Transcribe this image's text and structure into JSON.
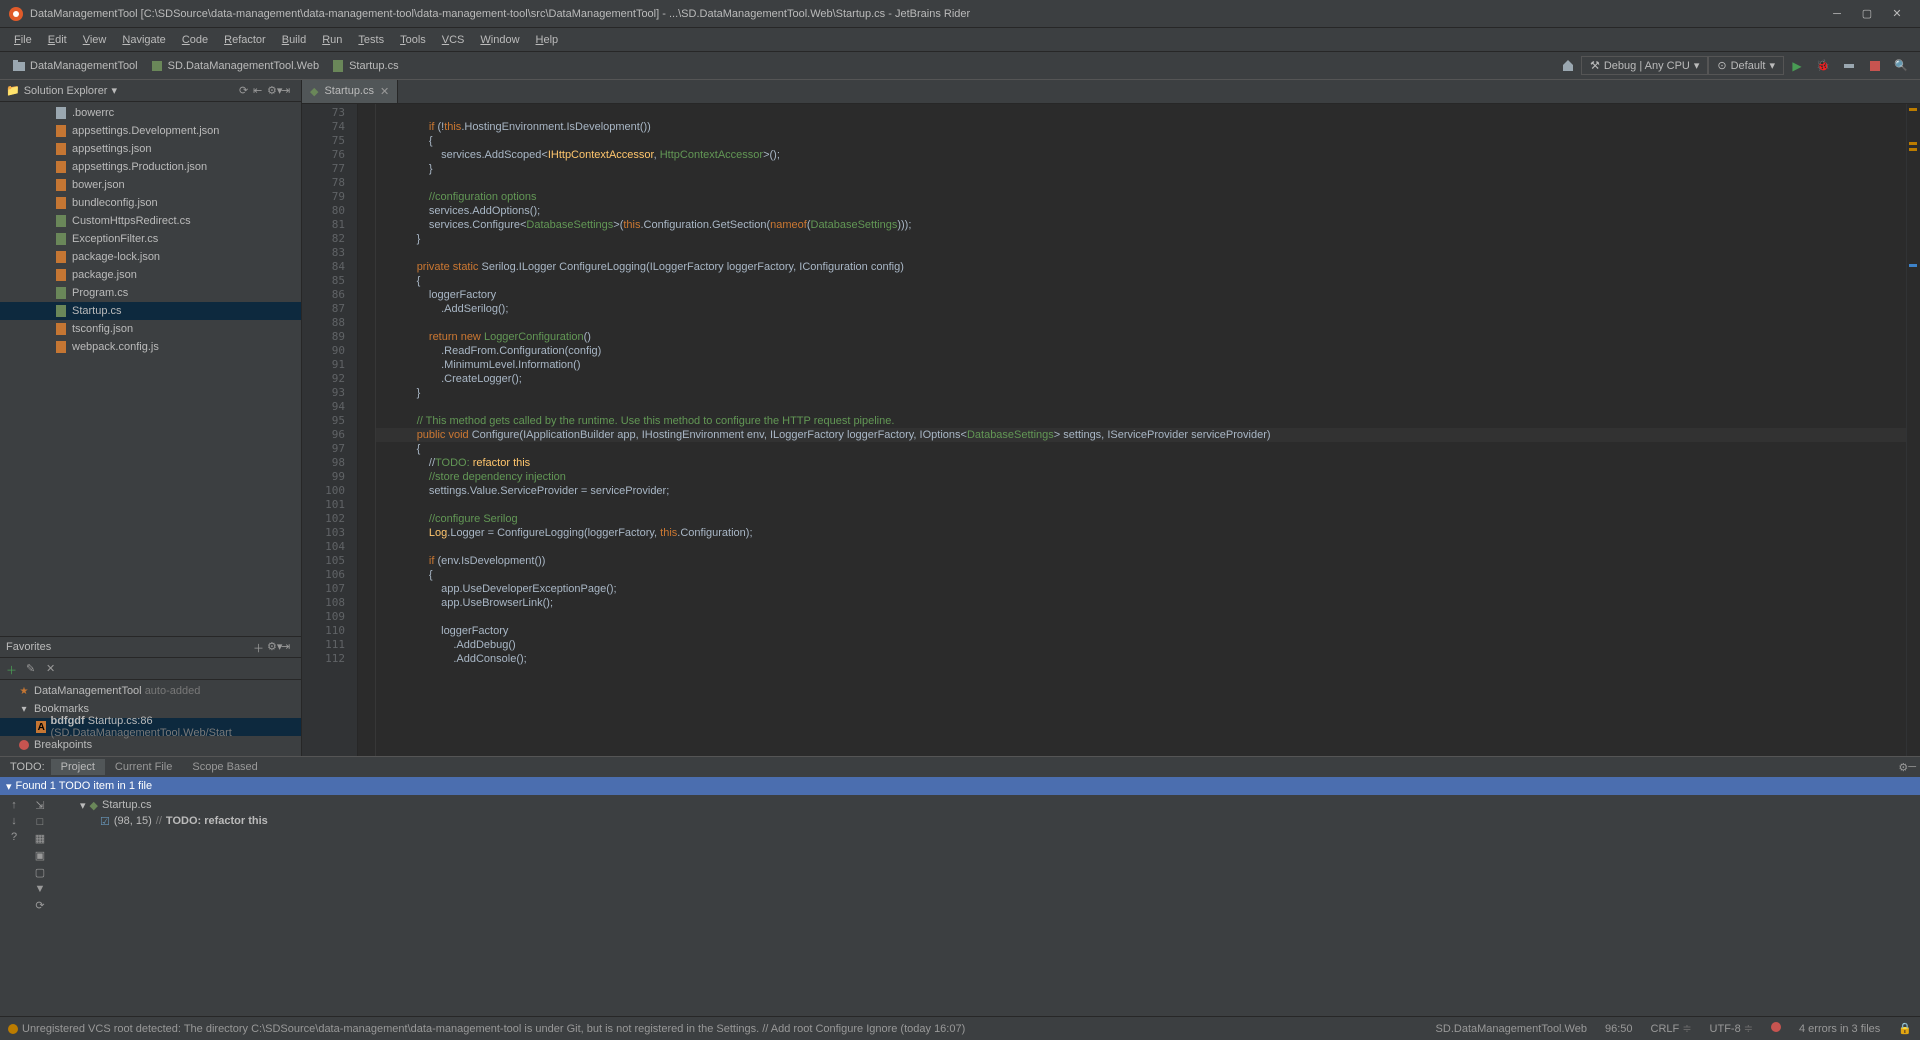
{
  "title": "DataManagementTool [C:\\SDSource\\data-management\\data-management-tool\\data-management-tool\\src\\DataManagementTool] - ...\\SD.DataManagementTool.Web\\Startup.cs - JetBrains Rider",
  "menus": [
    "File",
    "Edit",
    "View",
    "Navigate",
    "Code",
    "Refactor",
    "Build",
    "Run",
    "Tests",
    "Tools",
    "VCS",
    "Window",
    "Help"
  ],
  "crumbs": [
    "DataManagementTool",
    "SD.DataManagementTool.Web",
    "Startup.cs"
  ],
  "run_cfg": "Debug | Any CPU",
  "run_target": "Default",
  "solution_title": "Solution Explorer",
  "tree_items": [
    {
      "name": ".bowerrc",
      "t": "file"
    },
    {
      "name": "appsettings.Development.json",
      "t": "json"
    },
    {
      "name": "appsettings.json",
      "t": "json"
    },
    {
      "name": "appsettings.Production.json",
      "t": "json"
    },
    {
      "name": "bower.json",
      "t": "json"
    },
    {
      "name": "bundleconfig.json",
      "t": "json"
    },
    {
      "name": "CustomHttpsRedirect.cs",
      "t": "cs"
    },
    {
      "name": "ExceptionFilter.cs",
      "t": "cs"
    },
    {
      "name": "package-lock.json",
      "t": "json"
    },
    {
      "name": "package.json",
      "t": "json"
    },
    {
      "name": "Program.cs",
      "t": "cs"
    },
    {
      "name": "Startup.cs",
      "t": "cs",
      "sel": true
    },
    {
      "name": "tsconfig.json",
      "t": "json"
    },
    {
      "name": "webpack.config.js",
      "t": "js"
    }
  ],
  "fav_title": "Favorites",
  "fav_items": [
    {
      "txt": "DataManagementTool",
      "suffix": "auto-added",
      "star": true
    },
    {
      "txt": "Bookmarks",
      "exp": true
    },
    {
      "txt": "bdfgdf Startup.cs:86 (SD.DataManagementTool.Web/Start",
      "sel": true,
      "bm": true
    },
    {
      "txt": "Breakpoints",
      "bp": true
    }
  ],
  "tab_name": "Startup.cs",
  "first_line": 73,
  "code_lines": [
    {
      "n": 73,
      "txt": ""
    },
    {
      "n": 74,
      "txt": "                if (!this.HostingEnvironment.IsDevelopment())",
      "tokens": [
        [
          "                ",
          ""
        ],
        [
          "if",
          "kw"
        ],
        [
          " (!",
          ""
        ],
        [
          "this",
          "kw"
        ],
        [
          ".HostingEnvironment.IsDevelopment())",
          ""
        ]
      ]
    },
    {
      "n": 75,
      "txt": "                {"
    },
    {
      "n": 76,
      "txt": "                    services.AddScoped<IHttpContextAccessor, HttpContextAccessor>();",
      "tokens": [
        [
          "                    services.AddScoped<",
          ""
        ],
        [
          "IHttpContextAccessor",
          "cls"
        ],
        [
          ", ",
          ""
        ],
        [
          "HttpContextAccessor",
          "cmt-grn"
        ],
        [
          ">();",
          ""
        ]
      ]
    },
    {
      "n": 77,
      "txt": "                }"
    },
    {
      "n": 78,
      "txt": ""
    },
    {
      "n": 79,
      "txt": "                //configuration options",
      "tokens": [
        [
          "                ",
          ""
        ],
        [
          "//configuration options",
          "cmt-grn"
        ]
      ]
    },
    {
      "n": 80,
      "txt": "                services.AddOptions();"
    },
    {
      "n": 81,
      "txt": "                services.Configure<DatabaseSettings>(this.Configuration.GetSection(nameof(DatabaseSettings)));",
      "tokens": [
        [
          "                services.Configure<",
          ""
        ],
        [
          "DatabaseSettings",
          "cmt-grn"
        ],
        [
          ">(",
          ""
        ],
        [
          "this",
          "kw"
        ],
        [
          ".Configuration.GetSection(",
          ""
        ],
        [
          "nameof",
          "kw"
        ],
        [
          "(",
          ""
        ],
        [
          "DatabaseSettings",
          "cmt-grn"
        ],
        [
          ")));",
          ""
        ]
      ]
    },
    {
      "n": 82,
      "txt": "            }"
    },
    {
      "n": 83,
      "txt": ""
    },
    {
      "n": 84,
      "txt": "            private static Serilog.ILogger ConfigureLogging(ILoggerFactory loggerFactory, IConfiguration config)",
      "tokens": [
        [
          "            ",
          ""
        ],
        [
          "private static",
          "kw"
        ],
        [
          " Serilog.",
          ""
        ],
        [
          "ILogger",
          "type"
        ],
        [
          " ConfigureLogging(",
          ""
        ],
        [
          "ILoggerFactory",
          "type"
        ],
        [
          " loggerFactory, ",
          ""
        ],
        [
          "IConfiguration",
          "type"
        ],
        [
          " config)",
          ""
        ]
      ]
    },
    {
      "n": 85,
      "txt": "            {"
    },
    {
      "n": 86,
      "txt": "                loggerFactory",
      "gutter_mark": "A"
    },
    {
      "n": 87,
      "txt": "                    .AddSerilog();"
    },
    {
      "n": 88,
      "txt": ""
    },
    {
      "n": 89,
      "txt": "                return new LoggerConfiguration()",
      "tokens": [
        [
          "                ",
          ""
        ],
        [
          "return new",
          "kw"
        ],
        [
          " ",
          ""
        ],
        [
          "LoggerConfiguration",
          "cmt-grn"
        ],
        [
          "()",
          ""
        ]
      ]
    },
    {
      "n": 90,
      "txt": "                    .ReadFrom.Configuration(config)"
    },
    {
      "n": 91,
      "txt": "                    .MinimumLevel.Information()"
    },
    {
      "n": 92,
      "txt": "                    .CreateLogger();"
    },
    {
      "n": 93,
      "txt": "            }"
    },
    {
      "n": 94,
      "txt": ""
    },
    {
      "n": 95,
      "txt": "            // This method gets called by the runtime. Use this method to configure the HTTP request pipeline.",
      "tokens": [
        [
          "            ",
          ""
        ],
        [
          "// This method gets called by the runtime. Use this method to configure the HTTP request pipeline.",
          "cmt-grn"
        ]
      ]
    },
    {
      "n": 96,
      "txt": "            public void Configure(IApplicationBuilder app, IHostingEnvironment env, ILoggerFactory loggerFactory, IOptions<DatabaseSettings> settings, IServiceProvider serviceProvider)",
      "hl": true,
      "tokens": [
        [
          "            ",
          ""
        ],
        [
          "public void",
          "kw"
        ],
        [
          " Configure(",
          ""
        ],
        [
          "IApplicationBuilder",
          "type"
        ],
        [
          " app, ",
          ""
        ],
        [
          "IHostingEnvironment",
          "type"
        ],
        [
          " env, ",
          ""
        ],
        [
          "ILoggerFactory",
          "type"
        ],
        [
          " loggerFactory, ",
          ""
        ],
        [
          "IOptions",
          "type"
        ],
        [
          "<",
          ""
        ],
        [
          "DatabaseSettings",
          "cmt-grn"
        ],
        [
          "> settings, ",
          ""
        ],
        [
          "IServiceProvider",
          "type"
        ],
        [
          " serviceProvider)",
          ""
        ]
      ]
    },
    {
      "n": 97,
      "txt": "            {"
    },
    {
      "n": 98,
      "txt": "                //TODO: refactor this",
      "tokens": [
        [
          "                //",
          ""
        ],
        [
          "TODO: ",
          "cmt-grn"
        ],
        [
          "refactor this",
          "cls"
        ]
      ]
    },
    {
      "n": 99,
      "txt": "                //store dependency injection",
      "tokens": [
        [
          "                ",
          ""
        ],
        [
          "//store dependency injection",
          "cmt-grn"
        ]
      ]
    },
    {
      "n": 100,
      "txt": "                settings.Value.ServiceProvider = serviceProvider;"
    },
    {
      "n": 101,
      "txt": ""
    },
    {
      "n": 102,
      "txt": "                //configure Serilog",
      "tokens": [
        [
          "                ",
          ""
        ],
        [
          "//configure Serilog",
          "cmt-grn"
        ]
      ]
    },
    {
      "n": 103,
      "txt": "                Log.Logger = ConfigureLogging(loggerFactory, this.Configuration);",
      "tokens": [
        [
          "                ",
          ""
        ],
        [
          "Log",
          "cls"
        ],
        [
          ".Logger = ConfigureLogging(loggerFactory, ",
          ""
        ],
        [
          "this",
          "kw"
        ],
        [
          ".Configuration);",
          ""
        ]
      ]
    },
    {
      "n": 104,
      "txt": ""
    },
    {
      "n": 105,
      "txt": "                if (env.IsDevelopment())",
      "tokens": [
        [
          "                ",
          ""
        ],
        [
          "if",
          "kw"
        ],
        [
          " (env.IsDevelopment())",
          ""
        ]
      ]
    },
    {
      "n": 106,
      "txt": "                {"
    },
    {
      "n": 107,
      "txt": "                    app.UseDeveloperExceptionPage();"
    },
    {
      "n": 108,
      "txt": "                    app.UseBrowserLink();"
    },
    {
      "n": 109,
      "txt": ""
    },
    {
      "n": 110,
      "txt": "                    loggerFactory"
    },
    {
      "n": 111,
      "txt": "                        .AddDebug()"
    },
    {
      "n": 112,
      "txt": "                        .AddConsole();"
    }
  ],
  "todo": {
    "label": "TODO:",
    "tabs": [
      "Project",
      "Current File",
      "Scope Based"
    ],
    "active": 0,
    "found": "Found 1 TODO item in 1 file",
    "file": "Startup.cs",
    "loc": "(98, 15) ",
    "prefix": "//",
    "text": "TODO: refactor this"
  },
  "status": {
    "left": "Unregistered VCS root detected: The directory C:\\SDSource\\data-management\\data-management-tool is under Git, but is not registered in the Settings. // Add root  Configure  Ignore (today 16:07)",
    "proj": "SD.DataManagementTool.Web",
    "pos": "96:50",
    "crlf": "CRLF",
    "enc": "UTF-8",
    "err": "4 errors in 3 files"
  }
}
